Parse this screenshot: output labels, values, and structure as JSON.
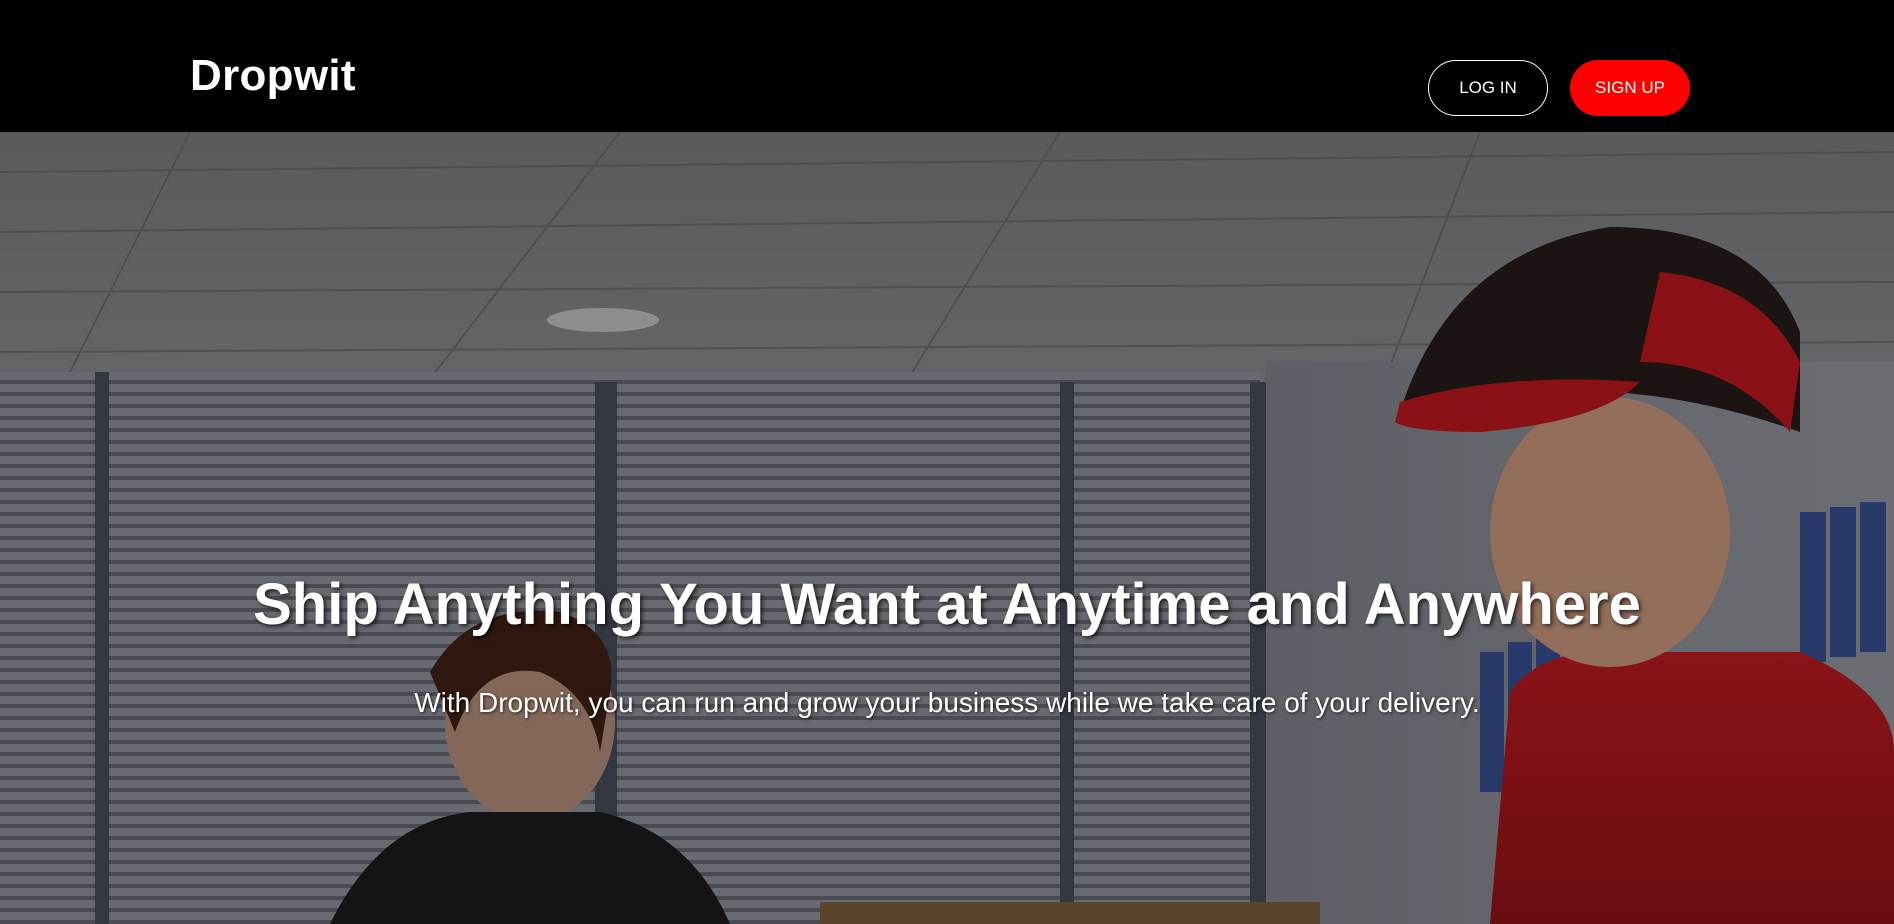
{
  "header": {
    "brand": "Dropwit",
    "login_label": "LOG IN",
    "signup_label": "SIGN UP"
  },
  "hero": {
    "title": "Ship Anything You Want at Anytime and Anywhere",
    "subtitle": "With Dropwit, you can run and grow your business while we take care of your delivery."
  },
  "colors": {
    "header_bg": "#000000",
    "signup_bg": "#ff0000",
    "text": "#ffffff"
  }
}
